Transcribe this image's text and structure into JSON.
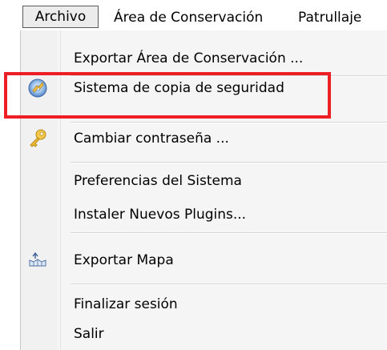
{
  "menubar": {
    "archivo": "Archivo",
    "area_conservacion": "Área de Conservación",
    "patrullaje": "Patrullaje"
  },
  "menu": {
    "items": [
      {
        "label": "Exportar Área de Conservación ...",
        "icon": null
      },
      {
        "label": "Sistema de copia de seguridad",
        "icon": "backup-disc-icon"
      },
      {
        "label": "Cambiar contraseña ...",
        "icon": "key-icon"
      },
      {
        "label": "Preferencias del Sistema",
        "icon": null
      },
      {
        "label": "Instaler Nuevos Plugins...",
        "icon": null
      },
      {
        "label": "Exportar Mapa",
        "icon": "map-export-icon"
      },
      {
        "label": "Finalizar sesión",
        "icon": null
      },
      {
        "label": "Salir",
        "icon": null
      }
    ]
  },
  "colors": {
    "highlight": "#ee1f24",
    "menu_background": "#f5f5f5",
    "icon_strip": "#f1f1f1"
  }
}
